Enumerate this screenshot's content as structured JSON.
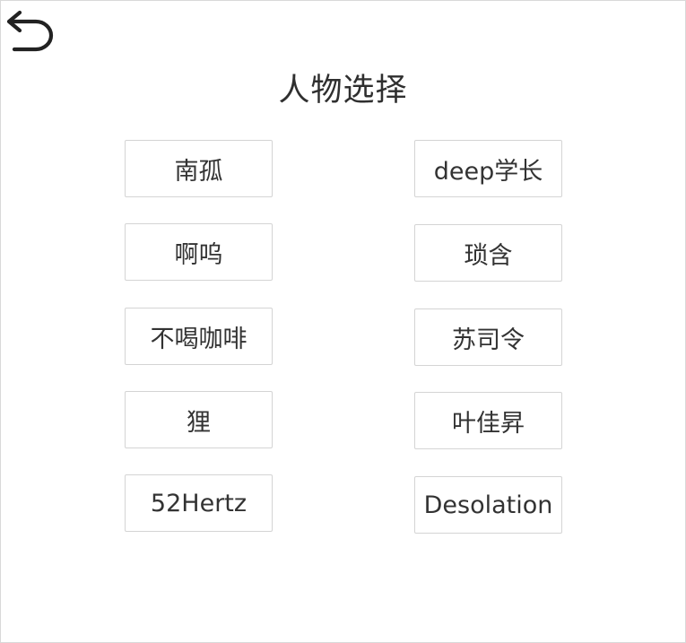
{
  "header": {
    "back_icon": "undo-arrow-icon",
    "title": "人物选择"
  },
  "characters": {
    "left": [
      "南孤",
      "啊呜",
      "不喝咖啡",
      "狸",
      "52Hertz"
    ],
    "right": [
      "deep学长",
      "琐含",
      "苏司令",
      "叶佳昇",
      "Desolation"
    ]
  },
  "colors": {
    "text": "#333333",
    "border": "#d4d4d4",
    "background": "#ffffff"
  }
}
